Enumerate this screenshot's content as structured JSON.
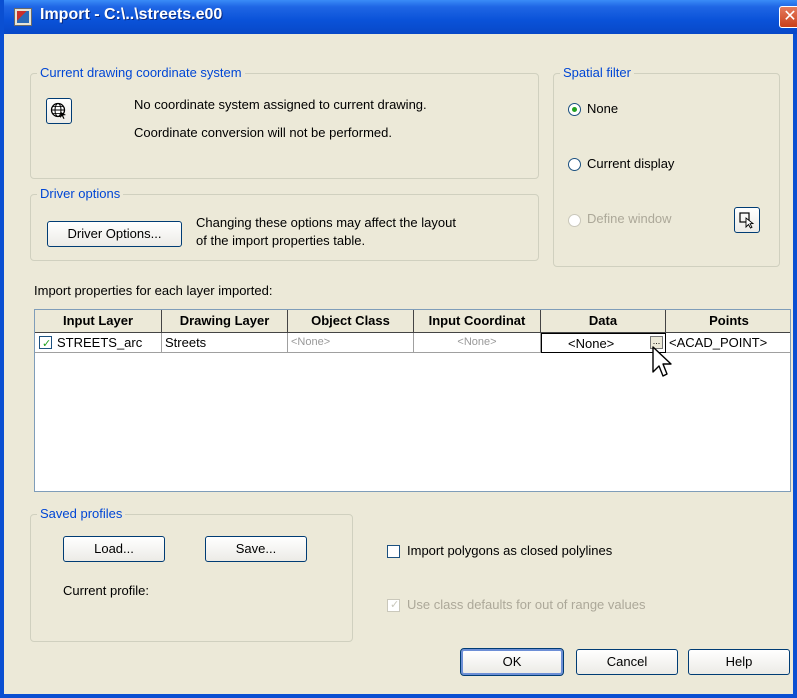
{
  "window": {
    "title": "Import - C:\\..\\streets.e00",
    "close_glyph": "✕"
  },
  "coord_system": {
    "legend": "Current drawing coordinate system",
    "line1": "No coordinate system assigned to current drawing.",
    "line2": "Coordinate conversion will not be performed.",
    "icon": "globe-icon"
  },
  "spatial_filter": {
    "legend": "Spatial filter",
    "options": [
      {
        "label": "None",
        "checked": true,
        "enabled": true
      },
      {
        "label": "Current display",
        "checked": false,
        "enabled": true
      },
      {
        "label": "Define window",
        "checked": false,
        "enabled": false
      }
    ],
    "pick_icon": "select-window-icon"
  },
  "driver_options": {
    "legend": "Driver options",
    "button": "Driver Options...",
    "note_line1": "Changing these options may affect the layout",
    "note_line2": "of the import properties table."
  },
  "import_props": {
    "label": "Import properties for each layer imported:",
    "columns": [
      "Input Layer",
      "Drawing Layer",
      "Object Class",
      "Input Coordinat",
      "Data",
      "Points"
    ],
    "rows": [
      {
        "checked": true,
        "input_layer": "STREETS_arc",
        "drawing_layer": "Streets",
        "object_class": "<None>",
        "input_coord": "<None>",
        "data": "<None>",
        "data_button": "...",
        "points": "<ACAD_POINT>"
      }
    ]
  },
  "saved_profiles": {
    "legend": "Saved profiles",
    "load": "Load...",
    "save": "Save...",
    "current_profile_label": "Current profile:"
  },
  "options": {
    "closed_polylines": {
      "label": "Import polygons as closed polylines",
      "checked": false,
      "enabled": true
    },
    "class_defaults": {
      "label": "Use class defaults for out of range values",
      "checked": true,
      "enabled": false
    }
  },
  "footer": {
    "ok": "OK",
    "cancel": "Cancel",
    "help": "Help"
  }
}
